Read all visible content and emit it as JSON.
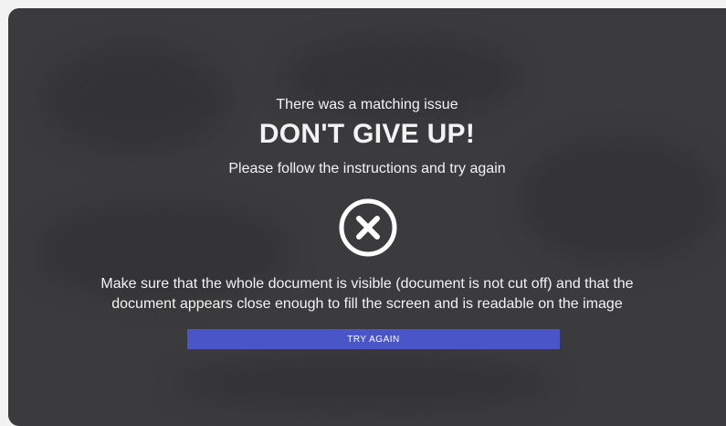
{
  "error_screen": {
    "subtitle": "There was a matching issue",
    "headline": "DON'T GIVE UP!",
    "instructions": "Please follow the instructions and try again",
    "icon": "close-circle-icon",
    "hint_line_1": "Make sure that the whole document is visible (document is not cut off) and that the",
    "hint_line_2": "document appears close enough to fill the screen and is readable on the image",
    "button_label": "TRY AGAIN"
  },
  "colors": {
    "background": "#3b3b3d",
    "text": "#f3f3f3",
    "button": "#4a55c8"
  }
}
